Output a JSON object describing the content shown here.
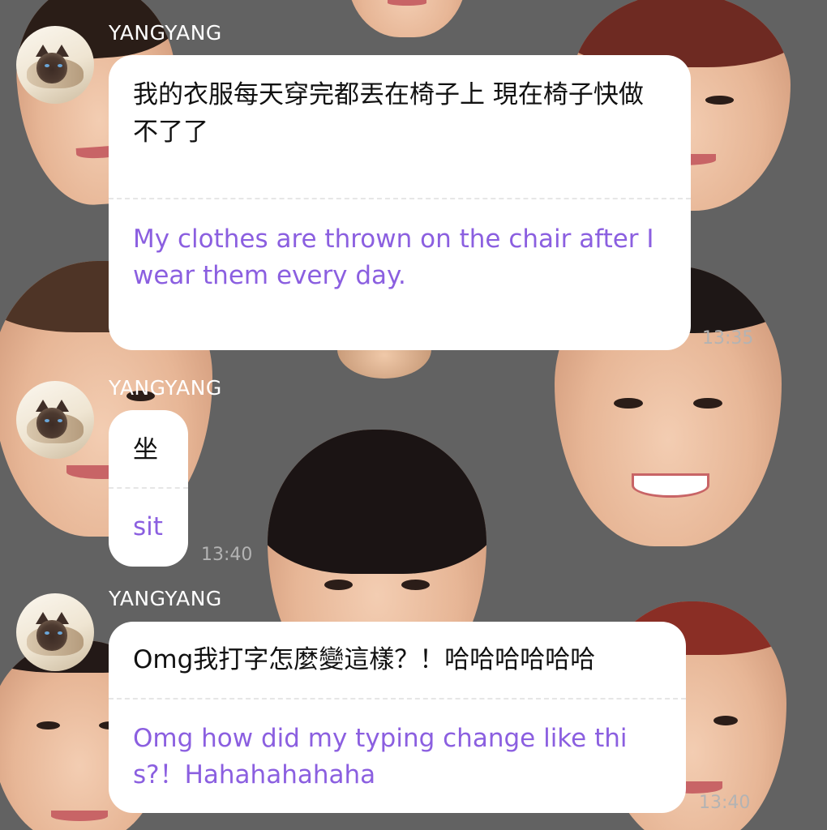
{
  "messages": [
    {
      "sender": "YANGYANG",
      "original": "我的衣服每天穿完都丟在椅子上 現在椅子快做不了了",
      "translation": "My clothes are thrown on the chair after I wear them every day.",
      "time": "13:35"
    },
    {
      "sender": "YANGYANG",
      "original": "坐",
      "translation": "sit",
      "time": "13:40"
    },
    {
      "sender": "YANGYANG",
      "original": "Omg我打字怎麼變這樣？！哈哈哈哈哈哈",
      "translation": "Omg how did my typing change like this?！Hahahahahaha",
      "time": "13:40"
    }
  ],
  "colors": {
    "background": "#626262",
    "bubble": "#ffffff",
    "original_text": "#111111",
    "translation_text": "#8b5fe0",
    "timestamp": "#8a8a8a",
    "sender_name": "#ffffff"
  },
  "icons": {
    "avatar": "siamese-cat-photo"
  }
}
